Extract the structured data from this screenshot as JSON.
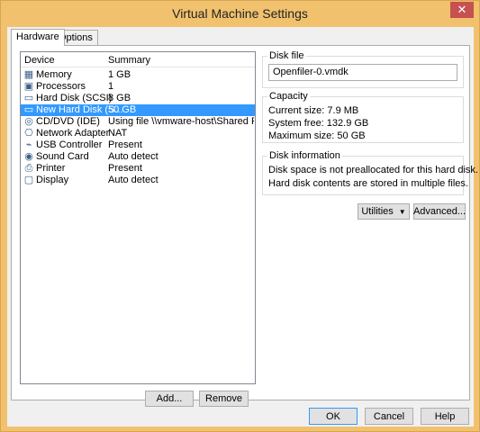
{
  "window": {
    "title": "Virtual Machine Settings",
    "close_glyph": "✕"
  },
  "tabs": [
    {
      "label": "Hardware",
      "active": true
    },
    {
      "label": "Options",
      "active": false
    }
  ],
  "device_list": {
    "headers": {
      "device": "Device",
      "summary": "Summary"
    },
    "rows": [
      {
        "name": "Memory",
        "summary": "1 GB",
        "icon": "memory-icon"
      },
      {
        "name": "Processors",
        "summary": "1",
        "icon": "processor-icon"
      },
      {
        "name": "Hard Disk (SCSI)",
        "summary": "8 GB",
        "icon": "hard-disk-icon"
      },
      {
        "name": "New Hard Disk (S...",
        "summary": "50 GB",
        "icon": "hard-disk-icon",
        "selected": true
      },
      {
        "name": "CD/DVD (IDE)",
        "summary": "Using file \\\\vmware-host\\Shared Folde...",
        "icon": "cd-dvd-icon"
      },
      {
        "name": "Network Adapter",
        "summary": "NAT",
        "icon": "network-adapter-icon"
      },
      {
        "name": "USB Controller",
        "summary": "Present",
        "icon": "usb-controller-icon"
      },
      {
        "name": "Sound Card",
        "summary": "Auto detect",
        "icon": "sound-card-icon"
      },
      {
        "name": "Printer",
        "summary": "Present",
        "icon": "printer-icon"
      },
      {
        "name": "Display",
        "summary": "Auto detect",
        "icon": "display-icon"
      }
    ],
    "add_label": "Add...",
    "remove_label": "Remove"
  },
  "disk_file": {
    "title": "Disk file",
    "value": "Openfiler-0.vmdk"
  },
  "capacity": {
    "title": "Capacity",
    "current_size": "Current size:  7.9 MB",
    "system_free": "System free:  132.9 GB",
    "maximum_size": "Maximum size:  50 GB"
  },
  "disk_information": {
    "title": "Disk information",
    "line1": "Disk space is not preallocated for this hard disk.",
    "line2": "Hard disk contents are stored in multiple files."
  },
  "utilities_label": "Utilities",
  "advanced_label": "Advanced...",
  "footer": {
    "ok": "OK",
    "cancel": "Cancel",
    "help": "Help"
  },
  "colors": {
    "selection": "#3399ff",
    "title_bar": "#f1c16e",
    "close_button": "#c75050"
  }
}
